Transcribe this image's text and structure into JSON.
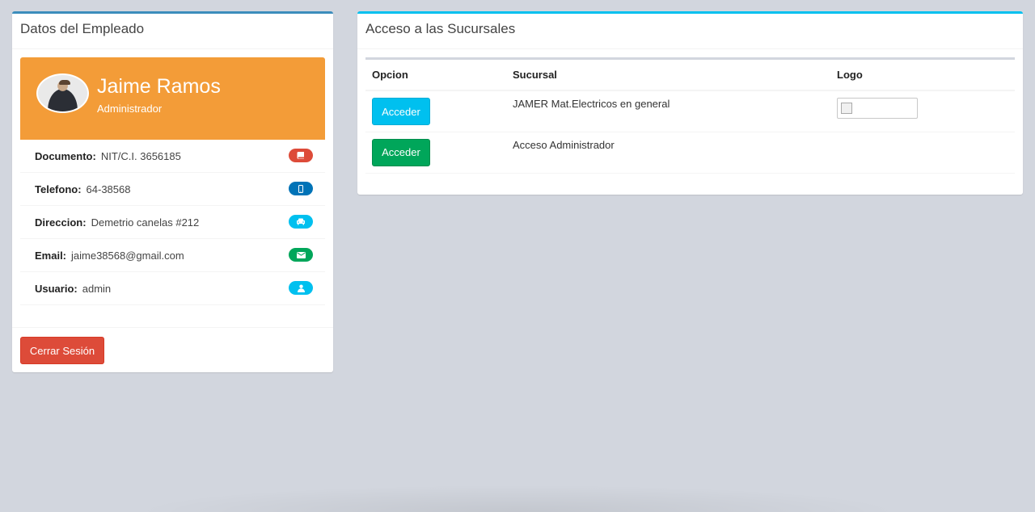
{
  "employee_box": {
    "title": "Datos del Empleado",
    "name": "Jaime Ramos",
    "role": "Administrador",
    "fields": [
      {
        "label": "Documento:",
        "value": "NIT/C.I. 3656185",
        "icon": "book-icon",
        "color": "#dd4b39"
      },
      {
        "label": "Telefono:",
        "value": "64-38568",
        "icon": "mobile-icon",
        "color": "#0073b7"
      },
      {
        "label": "Direccion:",
        "value": "Demetrio canelas #212",
        "icon": "taxi-icon",
        "color": "#00c0ef"
      },
      {
        "label": "Email:",
        "value": "jaime38568@gmail.com",
        "icon": "envelope-icon",
        "color": "#00a65a"
      },
      {
        "label": "Usuario:",
        "value": "admin",
        "icon": "user-icon",
        "color": "#00c0ef"
      }
    ],
    "logout_label": "Cerrar Sesión"
  },
  "branches_box": {
    "title": "Acceso a las Sucursales",
    "columns": [
      "Opcion",
      "Sucursal",
      "Logo"
    ],
    "rows": [
      {
        "button": "Acceder",
        "branch": "JAMER Mat.Electricos en general",
        "has_logo": true
      },
      {
        "button": "Acceder",
        "branch": "Acceso Administrador",
        "has_logo": false
      }
    ]
  }
}
